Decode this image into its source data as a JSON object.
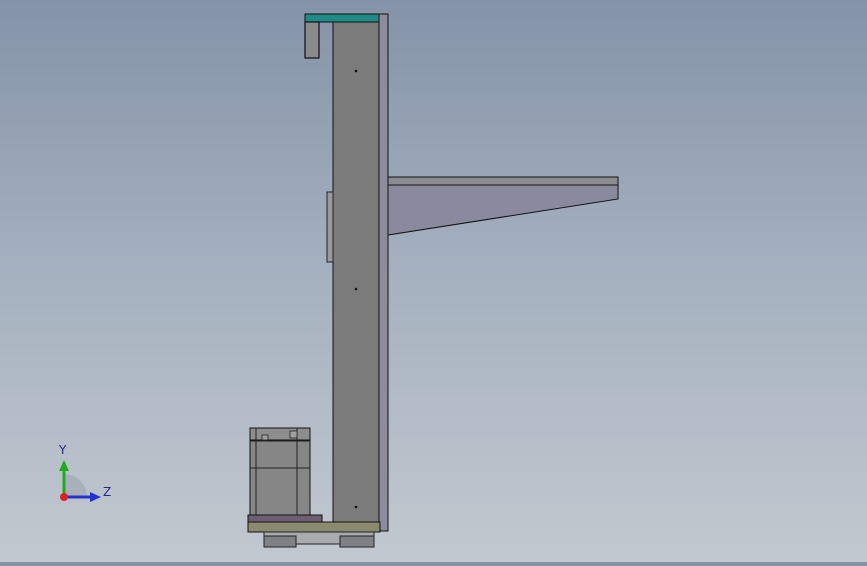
{
  "viewport": {
    "background_top": "#8493a8",
    "background_bottom": "#c2c8cf"
  },
  "model": {
    "body_color": "#7b7b7b",
    "side_panel_color": "#8c8c9c",
    "arm_color": "#8a8a9e",
    "top_cap_color": "#1f8a86",
    "base_color": "#8a8a6e",
    "pad_color": "#6e5e74",
    "motor_color": "#868686"
  },
  "triad": {
    "y_label": "Y",
    "z_label": "Z",
    "y_color": "#22aa22",
    "z_color": "#2233cc",
    "origin_color": "#dd2222"
  }
}
